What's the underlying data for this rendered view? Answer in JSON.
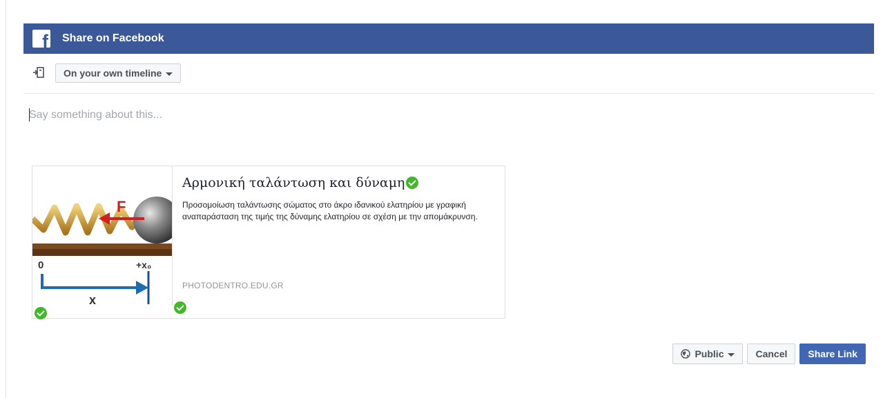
{
  "header": {
    "title": "Share on Facebook",
    "logo_letter": "f",
    "background": "#3b5998"
  },
  "audience": {
    "destination_label": "On your own timeline",
    "destination_icon": "share-destination-icon"
  },
  "composer": {
    "placeholder": "Say something about this..."
  },
  "link_card": {
    "title": "Αρμονική ταλάντωση και δύναμη",
    "description": "Προσομοίωση ταλάντωσης σώματος στο άκρο ιδανικού ελατηρίου με γραφική αναπαράσταση της τιμής της δύναμης ελατηρίου σε σχέση με την απομάκρυνση.",
    "domain": "PHOTODENTRO.EDU.GR",
    "thumbnail": {
      "force_label": "F",
      "zero_label": "0",
      "x0_label": "+x₀",
      "x_label": "x"
    },
    "verified_color": "#42b72a"
  },
  "footer": {
    "privacy_label": "Public",
    "cancel_label": "Cancel",
    "share_label": "Share Link",
    "share_color": "#4267b2"
  }
}
